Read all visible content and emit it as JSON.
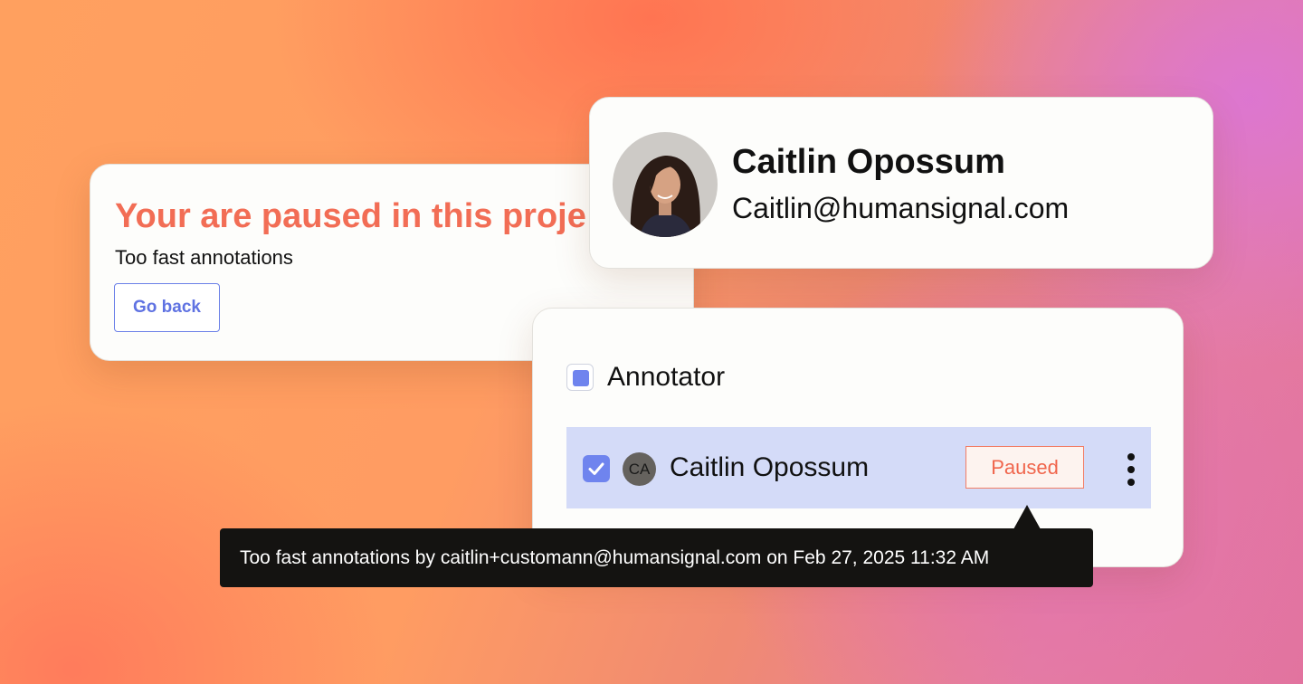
{
  "pause_card": {
    "title": "Your are paused in this proje",
    "reason": "Too fast annotations",
    "go_back_label": "Go back"
  },
  "profile": {
    "name": "Caitlin Opossum",
    "email": "Caitlin@humansignal.com"
  },
  "members": {
    "group_label": "Annotator",
    "row": {
      "initials": "CA",
      "name": "Caitlin Opossum",
      "status": "Paused"
    }
  },
  "tooltip": {
    "text": "Too fast annotations by caitlin+customann@humansignal.com on Feb 27, 2025 11:32 AM"
  },
  "colors": {
    "accent": "#6f84ee",
    "paused": "#f26d55",
    "row_highlight": "#d4dbf8",
    "tooltip_bg": "#141311"
  },
  "icons": {
    "row_checkbox": "checkmark-icon",
    "menu": "vertical-dots-icon"
  }
}
